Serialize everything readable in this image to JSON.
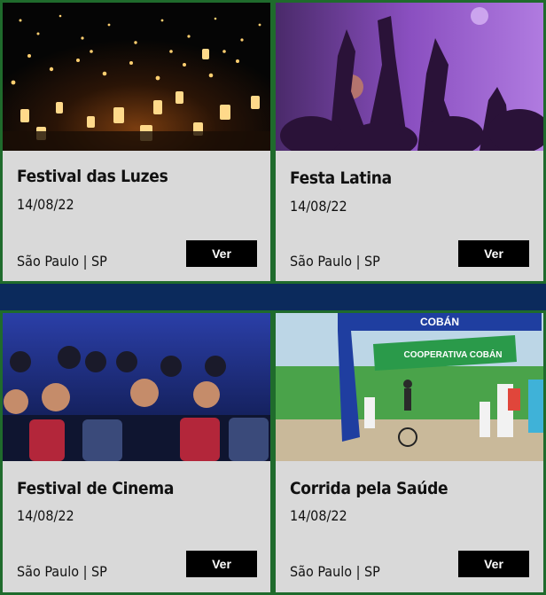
{
  "events": [
    {
      "title": "Festival das Luzes",
      "date": "14/08/22",
      "location": "São Paulo | SP",
      "button": "Ver",
      "image": "sky-lanterns-night"
    },
    {
      "title": "Festa Latina",
      "date": "14/08/22",
      "location": "São Paulo | SP",
      "button": "Ver",
      "image": "concert-crowd-purple-lights"
    },
    {
      "title": "Festival de Cinema",
      "date": "14/08/22",
      "location": "São Paulo | SP",
      "button": "Ver",
      "image": "cinema-audience"
    },
    {
      "title": "Corrida pela Saúde",
      "date": "14/08/22",
      "location": "São Paulo | SP",
      "button": "Ver",
      "image": "race-finish-arch",
      "banner_top": "COBÁN",
      "banner_arch": "COOPERATIVA COBÁN"
    }
  ],
  "colors": {
    "background": "#0b2a5c",
    "card": "#d9d9d9",
    "border": "#1f6b2c",
    "button": "#000000"
  }
}
